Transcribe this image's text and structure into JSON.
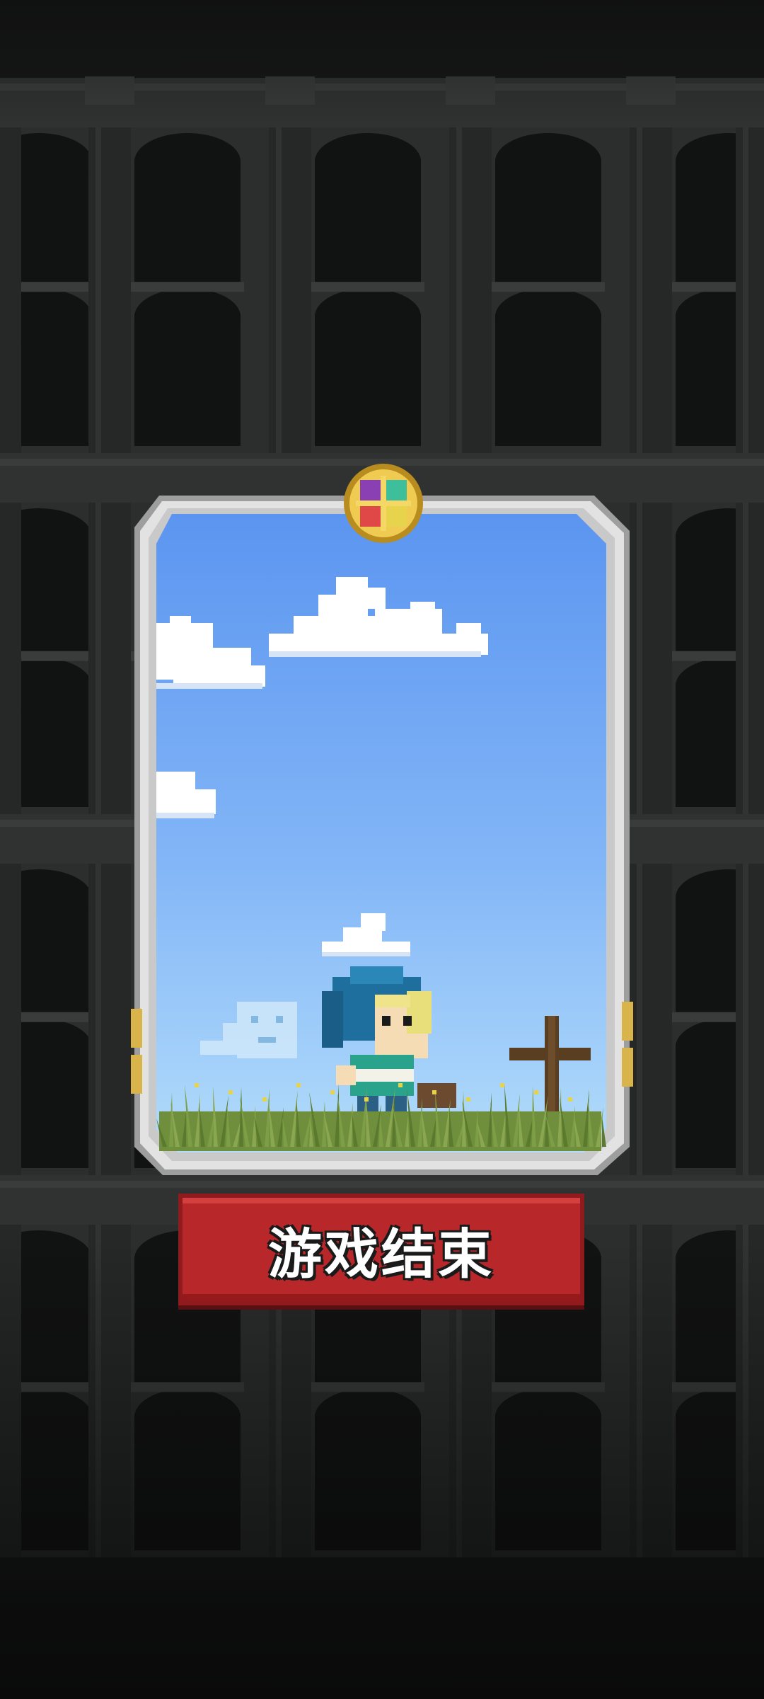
{
  "screen": {
    "game_over_label": "游戏结束"
  },
  "card": {
    "emblem": "four-color-quadrant-emblem",
    "scene": "pixel-sky-with-clouds-hero-ghost-and-grave-cross"
  },
  "colors": {
    "background": "#151616",
    "tower_wall": "#2c2e2e",
    "arch_window": "#111212",
    "card_frame": "#d9d9d9",
    "sky_top": "#5b95f0",
    "sky_bottom": "#a8d4fb",
    "button_red": "#b8282a",
    "button_text": "#ffffff"
  }
}
